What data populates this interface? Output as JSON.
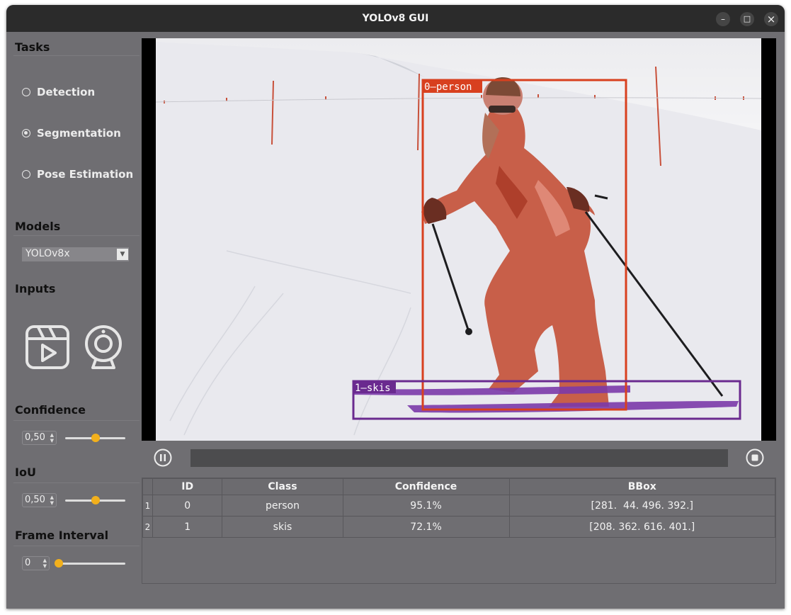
{
  "window": {
    "title": "YOLOv8 GUI",
    "controls": {
      "minimize": "–",
      "maximize": "□",
      "close": "×"
    }
  },
  "sidebar": {
    "tasks_heading": "Tasks",
    "tasks": [
      {
        "label": "Detection",
        "selected": false
      },
      {
        "label": "Segmentation",
        "selected": true
      },
      {
        "label": "Pose Estimation",
        "selected": false
      }
    ],
    "models_heading": "Models",
    "model_selected": "YOLOv8x",
    "inputs_heading": "Inputs",
    "input_icons": [
      "video-file-icon",
      "webcam-icon"
    ],
    "confidence": {
      "label": "Confidence",
      "value": "0,50",
      "fraction": 0.5
    },
    "iou": {
      "label": "IoU",
      "value": "0,50",
      "fraction": 0.5
    },
    "frame_interval": {
      "label": "Frame Interval",
      "value": "0",
      "fraction": 0.0
    }
  },
  "viewer": {
    "detections_overlay": [
      {
        "label": "0—person"
      },
      {
        "label": "1—skis"
      }
    ],
    "controls": {
      "pause_icon": "pause-icon",
      "stop_icon": "stop-icon",
      "progress": 0.0
    }
  },
  "results_table": {
    "columns": [
      "ID",
      "Class",
      "Confidence",
      "BBox"
    ],
    "rows": [
      {
        "row": "1",
        "id": "0",
        "class": "person",
        "confidence": "95.1%",
        "bbox": "[281.  44. 496. 392.]"
      },
      {
        "row": "2",
        "id": "1",
        "class": "skis",
        "confidence": "72.1%",
        "bbox": "[208. 362. 616. 401.]"
      }
    ]
  },
  "colors": {
    "accent": "#f2b01c",
    "person_box": "#d8401f",
    "skis_box": "#6a2a8f",
    "panel": "#6f6e72",
    "titlebar": "#2b2b2b"
  }
}
